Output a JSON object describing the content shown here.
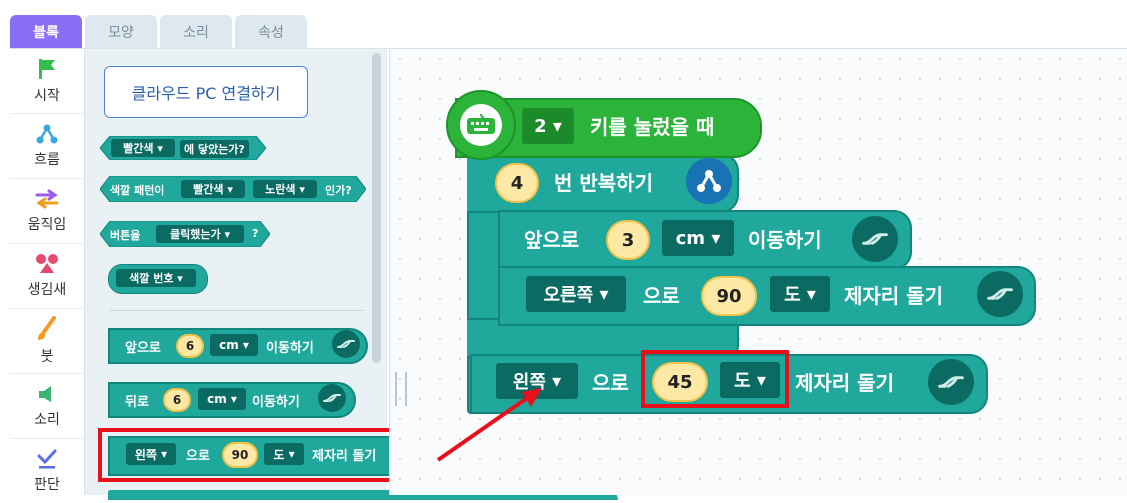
{
  "tabs": [
    {
      "label": "블록",
      "active": true
    },
    {
      "label": "모양",
      "active": false
    },
    {
      "label": "소리",
      "active": false
    },
    {
      "label": "속성",
      "active": false
    }
  ],
  "categories": [
    {
      "label": "시작",
      "icon": "flag-icon",
      "color": "#2fbf4a"
    },
    {
      "label": "흐름",
      "icon": "flow-icon",
      "color": "#3ba7e0"
    },
    {
      "label": "움직임",
      "icon": "arrows-icon",
      "color": "#9b5de5"
    },
    {
      "label": "생김새",
      "icon": "shapes-icon",
      "color": "#e84a6f"
    },
    {
      "label": "붓",
      "icon": "brush-icon",
      "color": "#f59a23"
    },
    {
      "label": "소리",
      "icon": "speaker-icon",
      "color": "#3cb371"
    },
    {
      "label": "판단",
      "icon": "check-icon",
      "color": "#5b6ee1"
    }
  ],
  "palette": {
    "cloud_button": "클라우드 PC 연결하기",
    "color_touch": {
      "color": "빨간색",
      "suffix": "에 닿았는가?"
    },
    "color_pattern": {
      "prefix": "색깔 패턴이",
      "color1": "빨간색",
      "color2": "노란색",
      "suffix": "인가?"
    },
    "button_clicked": {
      "prefix": "버튼을",
      "state": "클릭했는가",
      "suffix": "?"
    },
    "color_number": {
      "label": "색깔 번호"
    },
    "move_forward": {
      "label": "앞으로",
      "value": "6",
      "unit": "cm",
      "action": "이동하기"
    },
    "move_back": {
      "label": "뒤로",
      "value": "6",
      "unit": "cm",
      "action": "이동하기"
    },
    "rotate_left": {
      "dir": "왼쪽",
      "post": "으로",
      "value": "90",
      "unit": "도",
      "action": "제자리 돌기"
    }
  },
  "workspace": {
    "event": {
      "key": "2",
      "label": "키를 눌렀을 때"
    },
    "repeat": {
      "count": "4",
      "label": "번 반복하기"
    },
    "move": {
      "label": "앞으로",
      "value": "3",
      "unit": "cm",
      "action": "이동하기"
    },
    "turn_right": {
      "dir": "오른쪽",
      "post": "으로",
      "value": "90",
      "unit": "도",
      "action": "제자리 돌기"
    },
    "turn_left": {
      "dir": "왼쪽",
      "post": "으로",
      "value": "45",
      "unit": "도",
      "action": "제자리 돌기"
    }
  },
  "colors": {
    "accent": "#8a6ff4",
    "event_green": "#2bb33a",
    "block_teal": "#1fa89b",
    "block_dark": "#0b6b63",
    "highlight_red": "#e8101a"
  }
}
